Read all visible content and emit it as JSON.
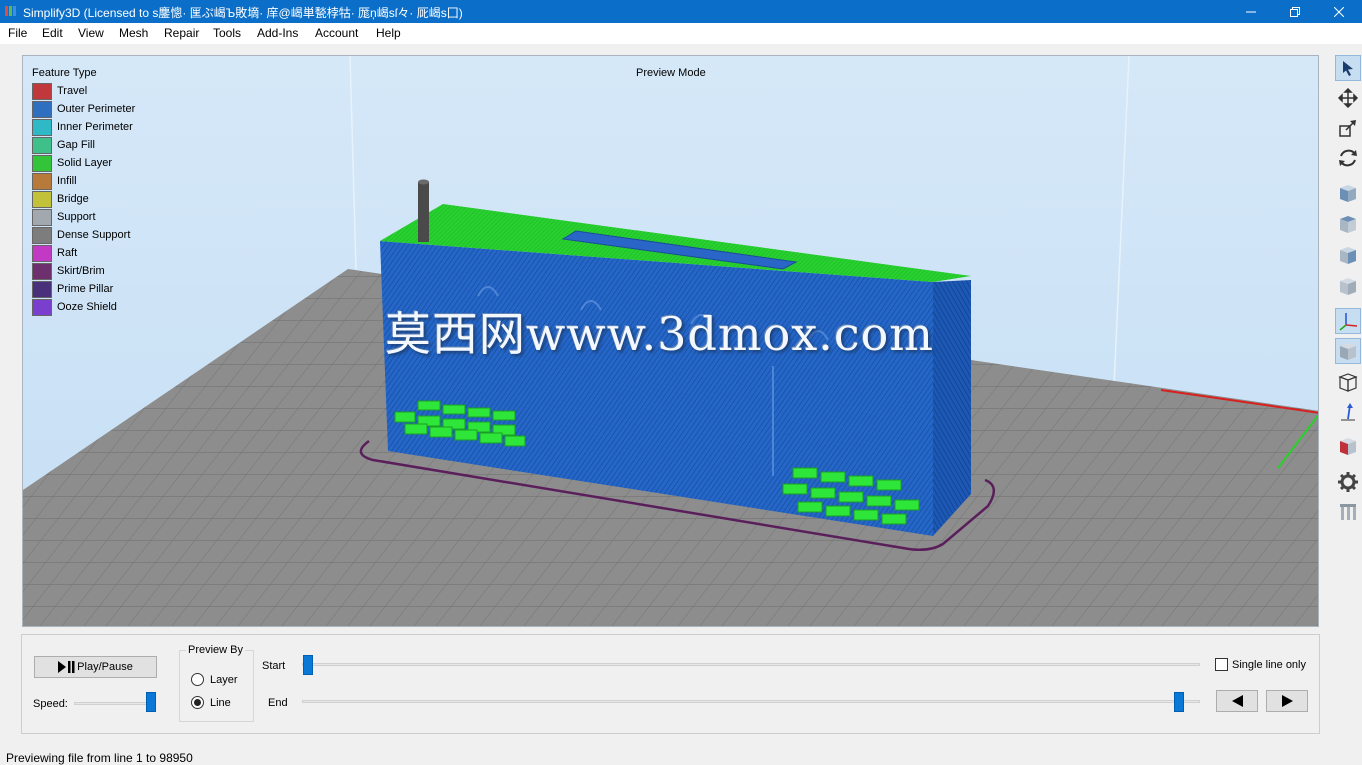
{
  "window": {
    "title": "Simplify3D (Licensed to s鏖憁· 匩ぷ嵑Ъ敗墑· 庠@嵑単甃桲牯· 厖ņ嵑sſ々· 厑嵑s囗)"
  },
  "menu": [
    "File",
    "Edit",
    "View",
    "Mesh",
    "Repair",
    "Tools",
    "Add-Ins",
    "Account",
    "Help"
  ],
  "viewport": {
    "mode_label": "Preview Mode",
    "watermark": "莫西网www.3dmox.com",
    "legend": {
      "title": "Feature Type",
      "items": [
        {
          "label": "Travel",
          "color": "#c0383c"
        },
        {
          "label": "Outer Perimeter",
          "color": "#2f6fc0"
        },
        {
          "label": "Inner Perimeter",
          "color": "#2fb8c6"
        },
        {
          "label": "Gap Fill",
          "color": "#3fbf8a"
        },
        {
          "label": "Solid Layer",
          "color": "#34c43a"
        },
        {
          "label": "Infill",
          "color": "#b87a3a"
        },
        {
          "label": "Bridge",
          "color": "#c2c23a"
        },
        {
          "label": "Support",
          "color": "#a3a8ae"
        },
        {
          "label": "Dense Support",
          "color": "#7d7d7d"
        },
        {
          "label": "Raft",
          "color": "#c23ac4"
        },
        {
          "label": "Skirt/Brim",
          "color": "#6e2f6e"
        },
        {
          "label": "Prime Pillar",
          "color": "#4a2f7a"
        },
        {
          "label": "Ooze Shield",
          "color": "#7a3fcf"
        }
      ]
    }
  },
  "toolbar": [
    "select-cursor-icon",
    "move-icon",
    "scale-icon",
    "rotate-icon",
    "view-cube-front-icon",
    "view-cube-top-icon",
    "view-cube-side-icon",
    "view-cube-back-icon",
    "axes-icon",
    "solid-view-icon",
    "wireframe-view-icon",
    "build-direction-icon",
    "cross-section-icon",
    "settings-gear-icon",
    "supports-icon"
  ],
  "controls": {
    "play_pause_label": "Play/Pause",
    "speed_label": "Speed:",
    "speed_value": 1.0,
    "preview_by": {
      "title": "Preview By",
      "options": [
        "Layer",
        "Line"
      ],
      "selected": "Line"
    },
    "start_label": "Start",
    "end_label": "End",
    "start_position": 0.0,
    "end_position": 0.98,
    "single_line_only_label": "Single line only",
    "single_line_only_checked": false
  },
  "status": {
    "text": "Previewing file from line 1 to 98950"
  },
  "colors": {
    "titlebar": "#0b6fc9",
    "accent": "#0a78d7",
    "viewport_sky": "#cfe5f7",
    "bed": "#8e8e8e",
    "model_blue": "#1f62c4",
    "model_green": "#26d02e"
  }
}
